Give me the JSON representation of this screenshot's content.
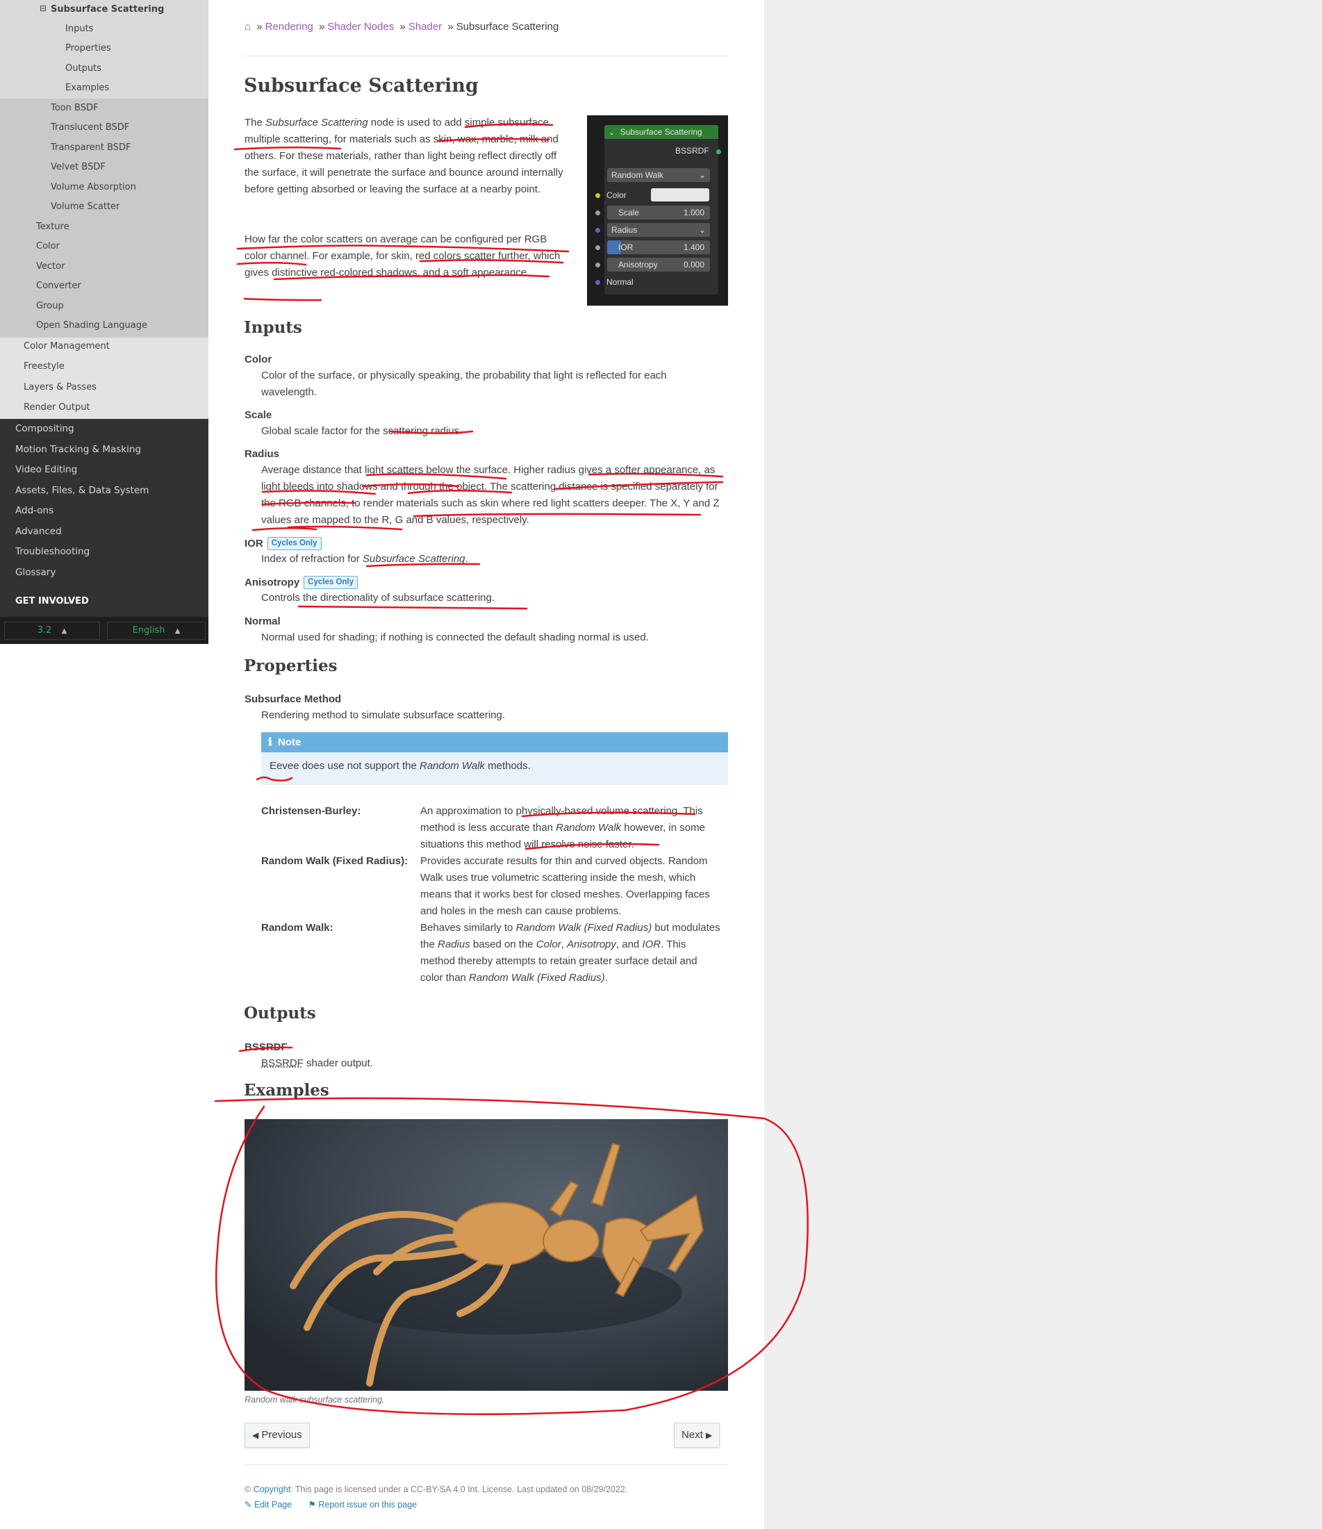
{
  "sidebar": {
    "active": "Subsurface Scattering",
    "sub": [
      "Inputs",
      "Properties",
      "Outputs",
      "Examples"
    ],
    "shaders": [
      "Toon BSDF",
      "Translucent BSDF",
      "Transparent BSDF",
      "Velvet BSDF",
      "Volume Absorption",
      "Volume Scatter"
    ],
    "nodes": [
      "Texture",
      "Color",
      "Vector",
      "Converter",
      "Group",
      "Open Shading Language"
    ],
    "rendering": [
      "Color Management",
      "Freestyle",
      "Layers & Passes",
      "Render Output"
    ],
    "main": [
      "Compositing",
      "Motion Tracking & Masking",
      "Video Editing",
      "Assets, Files, & Data System",
      "Add-ons",
      "Advanced",
      "Troubleshooting",
      "Glossary"
    ],
    "get_involved": "GET INVOLVED",
    "version": "3.2",
    "language": "English",
    "expand_glyph": "⊟",
    "caret": "▲"
  },
  "breadcrumb": {
    "home_icon": "⌂",
    "sep": "»",
    "items": [
      "Rendering",
      "Shader Nodes",
      "Shader"
    ],
    "current": "Subsurface Scattering"
  },
  "title": "Subsurface Scattering",
  "intro": {
    "p1": [
      "The",
      "Subsurface Scattering",
      "node is used to add simple subsurface multiple scattering, for materials such as skin, wax, marble, milk and others. For these materials, rather than light being reflect directly off the surface, it will penetrate the surface and bounce around internally before getting absorbed or leaving the surface at a nearby point."
    ],
    "p2": "How far the color scatters on average can be configured per RGB color channel. For example, for skin, red colors scatter further, which gives distinctive red-colored shadows, and a soft appearance."
  },
  "node": {
    "title": "Subsurface Scattering",
    "output": "BSSRDF",
    "method": "Random Walk",
    "color_label": "Color",
    "scale_label": "Scale",
    "scale_value": "1.000",
    "radius_label": "Radius",
    "ior_label": "IOR",
    "ior_value": "1.400",
    "aniso_label": "Anisotropy",
    "aniso_value": "0.000",
    "normal_label": "Normal",
    "chev": "⌄"
  },
  "inputs": {
    "heading": "Inputs",
    "color": {
      "term": "Color",
      "desc": "Color of the surface, or physically speaking, the probability that light is reflected for each wavelength."
    },
    "scale": {
      "term": "Scale",
      "desc": "Global scale factor for the scattering radius."
    },
    "radius": {
      "term": "Radius",
      "desc": "Average distance that light scatters below the surface. Higher radius gives a softer appearance, as light bleeds into shadows and through the object. The scattering distance is specified separately for the RGB channels, to render materials such as skin where red light scatters deeper. The X, Y and Z values are mapped to the R, G and B values, respectively."
    },
    "ior": {
      "term": "IOR",
      "badge": "Cycles Only",
      "desc_pre": "Index of refraction for",
      "desc_em": "Subsurface Scattering",
      "desc_post": "."
    },
    "anisotropy": {
      "term": "Anisotropy",
      "badge": "Cycles Only",
      "desc": "Controls the directionality of subsurface scattering."
    },
    "normal": {
      "term": "Normal",
      "desc": "Normal used for shading; if nothing is connected the default shading normal is used."
    }
  },
  "properties": {
    "heading": "Properties",
    "method_term": "Subsurface Method",
    "method_desc": "Rendering method to simulate subsurface scattering.",
    "note_title": "Note",
    "note_icon": "ℹ",
    "note_pre": "Eevee does use not support the",
    "note_em": "Random Walk",
    "note_post": "methods.",
    "options": [
      {
        "term": "Christensen-Burley:",
        "lines": [
          "An approximation to physically-based volume scattering. This",
          "method is less accurate than |Random Walk| however, in some",
          "situations this method will resolve noise faster."
        ]
      },
      {
        "term": "Random Walk (Fixed Radius):",
        "lines": [
          "Provides accurate results for thin and curved objects. Random",
          "Walk uses true volumetric scattering inside the mesh, which",
          "means that it works best for closed meshes. Overlapping faces",
          "and holes in the mesh can cause problems."
        ]
      },
      {
        "term": "Random Walk:",
        "lines": [
          "Behaves similarly to |Random Walk (Fixed Radius)| but modulates",
          "the |Radius| based on the |Color|, |Anisotropy|, and |IOR|. This",
          "method thereby attempts to retain greater surface detail and",
          "color than |Random Walk (Fixed Radius)|."
        ]
      }
    ]
  },
  "outputs": {
    "heading": "Outputs",
    "term": "BSSRDF",
    "desc_abbr": "BSSRDF",
    "desc_rest": "shader output."
  },
  "examples": {
    "heading": "Examples",
    "caption": "Random walk subsurface scattering."
  },
  "nav": {
    "prev": "Previous",
    "next": "Next",
    "prev_icon": "◀",
    "next_icon": "▶"
  },
  "footer": {
    "copyright_symbol": "©",
    "copyright_link": "Copyright",
    "license": ": This page is licensed under a CC-BY-SA 4.0 Int. License. Last updated on 08/29/2022.",
    "edit": "Edit Page",
    "report": "Report issue on this page",
    "edit_icon": "✎",
    "report_icon": "⚑"
  },
  "colors": {
    "link": "#9b59b6",
    "note": "#6ab0de",
    "node_header": "#2e7d32",
    "annotation": "#e0141e"
  }
}
